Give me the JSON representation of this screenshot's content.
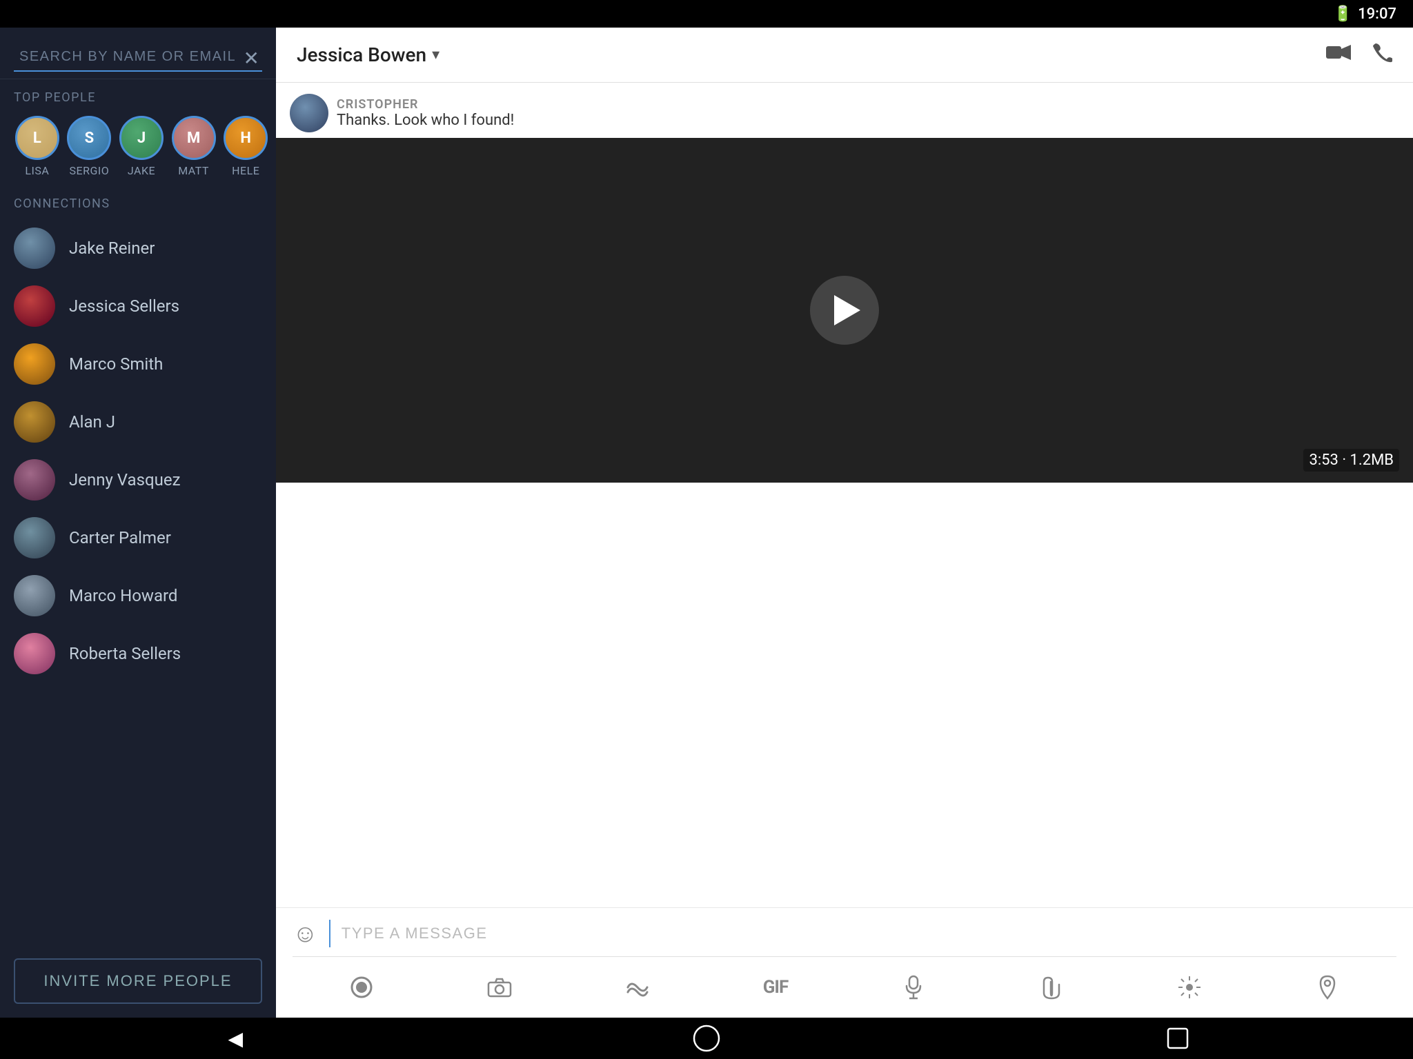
{
  "status_bar": {
    "time": "19:07",
    "battery_icon": "🔋"
  },
  "left_panel": {
    "search_placeholder": "SEARCH BY NAME OR EMAIL",
    "top_people_label": "TOP PEOPLE",
    "top_people": [
      {
        "name": "LISA",
        "avatar_class": "avatar-lisa",
        "initial": "L"
      },
      {
        "name": "SERGIO",
        "avatar_class": "avatar-sergio",
        "initial": "S"
      },
      {
        "name": "JAKE",
        "avatar_class": "avatar-jake",
        "initial": "J"
      },
      {
        "name": "MATT",
        "avatar_class": "avatar-matt",
        "initial": "M"
      },
      {
        "name": "HELE",
        "avatar_class": "avatar-hele",
        "initial": "H"
      }
    ],
    "connections_label": "CONNECTIONS",
    "connections": [
      {
        "name": "Jake Reiner",
        "avatar_class": "conn-jake"
      },
      {
        "name": "Jessica Sellers",
        "avatar_class": "conn-jessica-s"
      },
      {
        "name": "Marco Smith",
        "avatar_class": "conn-marco-s"
      },
      {
        "name": "Alan J",
        "avatar_class": "conn-alan"
      },
      {
        "name": "Jenny Vasquez",
        "avatar_class": "conn-jenny"
      },
      {
        "name": "Carter Palmer",
        "avatar_class": "conn-carter"
      },
      {
        "name": "Marco Howard",
        "avatar_class": "conn-marco-h"
      },
      {
        "name": "Roberta Sellers",
        "avatar_class": "conn-roberta"
      }
    ],
    "invite_button": "INVITE MORE PEOPLE"
  },
  "chat": {
    "title": "Jessica Bowen",
    "title_chevron": "▾",
    "sender_name": "CRISTOPHER",
    "message_text": "Thanks. Look who I found!",
    "video_meta": "3:53 · 1.2MB",
    "input_placeholder": "TYPE A MESSAGE",
    "video_icon": "📹",
    "call_icon": "📞"
  },
  "bottom_nav": {
    "back": "◀",
    "home": "○",
    "recent": "□"
  }
}
